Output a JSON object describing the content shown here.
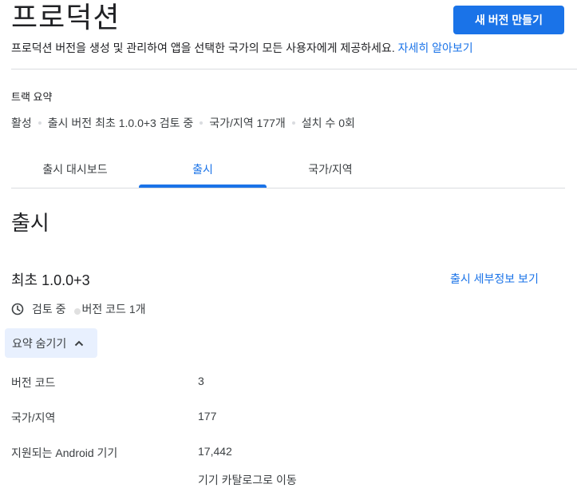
{
  "header": {
    "title": "프로덕션",
    "create_button": "새 버전 만들기",
    "description": "프로덕션 버전을 생성 및 관리하여 앱을 선택한 국가의 모든 사용자에게 제공하세요.",
    "learn_more": "자세히 알아보기"
  },
  "track_summary": {
    "label": "트랙 요약",
    "items": [
      "활성",
      "출시 버전 최초 1.0.0+3 검토 중",
      "국가/지역 177개",
      "설치 수 0회"
    ]
  },
  "tabs": [
    {
      "label": "출시 대시보드",
      "active": false
    },
    {
      "label": "출시",
      "active": true
    },
    {
      "label": "국가/지역",
      "active": false
    }
  ],
  "main": {
    "heading": "출시",
    "release": {
      "name": "최초 1.0.0+3",
      "details_link": "출시 세부정보 보기",
      "status": "검토 중",
      "version_codes": "버전 코드 1개"
    },
    "toggle_label": "요약 숨기기",
    "details": [
      {
        "key": "버전 코드",
        "value": "3",
        "is_link": true
      },
      {
        "key": "국가/지역",
        "value": "177",
        "is_link": false
      },
      {
        "key": "지원되는 Android 기기",
        "value": "17,442",
        "is_link": false
      }
    ],
    "catalog_link": "기기 카탈로그로 이동"
  },
  "colors": {
    "accent": "#1a73e8",
    "toggle_bg": "#e8f0fe",
    "divider": "#dadce0"
  },
  "icons": [
    "clock-icon",
    "chevron-up-icon"
  ]
}
